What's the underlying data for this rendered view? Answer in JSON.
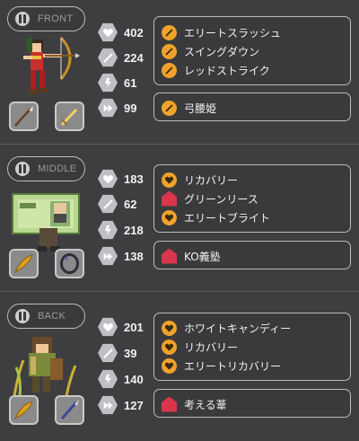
{
  "colors": {
    "background": "#3e3e40",
    "stat_icon": "#bfc0c4",
    "skill_orange": "#f0a22a",
    "skill_red": "#d9364a"
  },
  "panels": [
    {
      "position_label": "FRONT",
      "character_icon": "archer-girl-sprite",
      "weapons": [
        "spear-icon",
        "dagger-icon"
      ],
      "stats": {
        "hp": "402",
        "attack": "224",
        "magic": "61",
        "speed": "99"
      },
      "skills": [
        {
          "icon": "sword-skill-icon",
          "name": "エリートスラッシュ"
        },
        {
          "icon": "sword-skill-icon",
          "name": "スイングダウン"
        },
        {
          "icon": "sword-skill-icon",
          "name": "レッドストライク"
        }
      ],
      "passive": {
        "icon": "sword-skill-icon",
        "name": "弓腰姫"
      }
    },
    {
      "position_label": "MIDDLE",
      "character_icon": "banknote-man-sprite",
      "weapons": [
        "quill-icon",
        "ring-icon"
      ],
      "stats": {
        "hp": "183",
        "attack": "62",
        "magic": "218",
        "speed": "138"
      },
      "skills": [
        {
          "icon": "heart-skill-icon",
          "name": "リカバリー"
        },
        {
          "icon": "house-skill-icon",
          "name": "グリーンリース"
        },
        {
          "icon": "heart-skill-icon",
          "name": "エリートブライト"
        }
      ],
      "passive": {
        "icon": "house-skill-icon",
        "name": "KO義塾"
      }
    },
    {
      "position_label": "BACK",
      "character_icon": "farmer-girl-sprite",
      "weapons": [
        "quill-icon",
        "pen-icon"
      ],
      "stats": {
        "hp": "201",
        "attack": "39",
        "magic": "140",
        "speed": "127"
      },
      "skills": [
        {
          "icon": "heart-skill-icon",
          "name": "ホワイトキャンディー"
        },
        {
          "icon": "heart-skill-icon",
          "name": "リカバリー"
        },
        {
          "icon": "heart-skill-icon",
          "name": "エリートリカバリー"
        }
      ],
      "passive": {
        "icon": "house-skill-icon",
        "name": "考える葦"
      }
    }
  ]
}
